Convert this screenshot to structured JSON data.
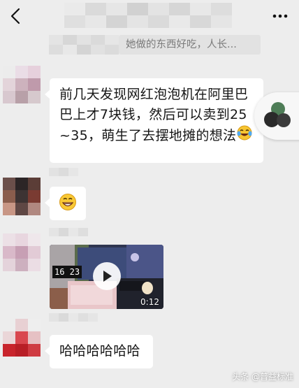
{
  "header": {
    "back_icon": "chevron-left-icon",
    "more_icon": "more-dots-icon"
  },
  "quote": {
    "text": "她做的东西好吃，人长..."
  },
  "messages": [
    {
      "type": "text",
      "text": "前几天发现网红泡泡机在阿里巴巴上才7块钱，然后可以卖到25~35，萌生了去摆地摊的想法",
      "emoji": "laughing-tears-emoji"
    },
    {
      "type": "emoji",
      "emoji": "grinning-face-emoji"
    },
    {
      "type": "video",
      "clock_text": "16 23",
      "duration": "0:12"
    },
    {
      "type": "text",
      "text": "哈哈哈哈哈哈"
    }
  ],
  "watermark": {
    "text": "头条 @普益标准"
  },
  "colors": {
    "background": "#ededed",
    "bubble": "#ffffff",
    "quote_bg": "#e2e2e2"
  }
}
